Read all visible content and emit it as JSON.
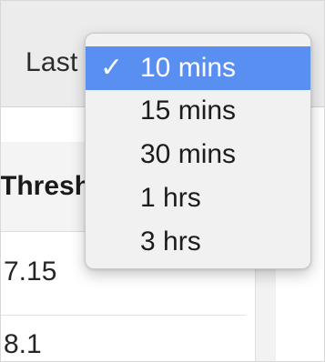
{
  "toolbar": {
    "time_range_label": "Last"
  },
  "table": {
    "header": "Thresh",
    "rows": [
      "7.15",
      "8.1"
    ]
  },
  "dropdown": {
    "selected_index": 0,
    "check_mark": "✓",
    "options": [
      "10 mins",
      "15 mins",
      "30 mins",
      "1 hrs",
      "3 hrs"
    ]
  },
  "colors": {
    "selection_highlight": "#5a8ff2",
    "menu_background": "#f1f1f1"
  }
}
